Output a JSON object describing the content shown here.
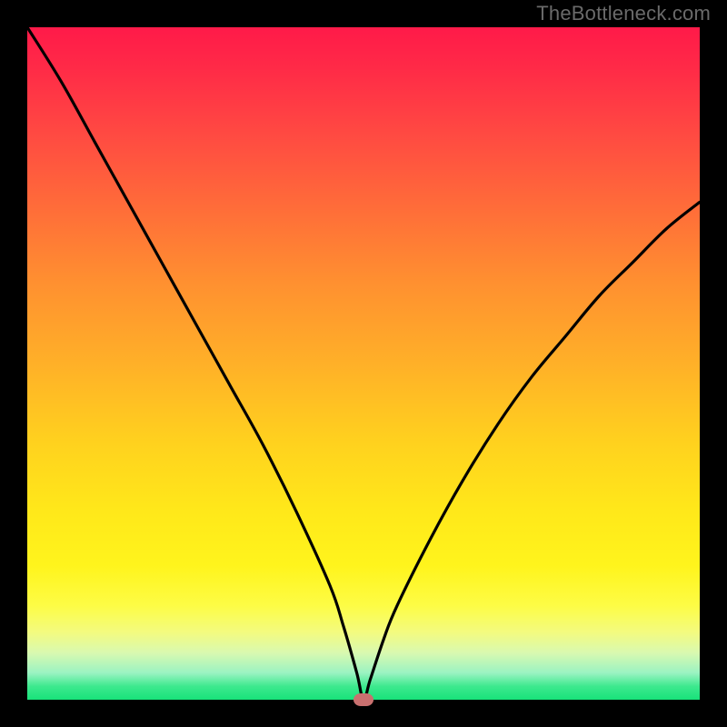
{
  "watermark": "TheBottleneck.com",
  "colors": {
    "frame": "#000000",
    "curve": "#000000",
    "marker": "#c9706f"
  },
  "chart_data": {
    "type": "line",
    "title": "",
    "xlabel": "",
    "ylabel": "",
    "xlim": [
      0,
      100
    ],
    "ylim": [
      0,
      100
    ],
    "grid": false,
    "legend": false,
    "x": [
      0,
      5,
      10,
      15,
      20,
      25,
      30,
      35,
      40,
      45,
      47,
      49,
      50,
      51,
      53,
      55,
      60,
      65,
      70,
      75,
      80,
      85,
      90,
      95,
      100
    ],
    "values": [
      100,
      92,
      83,
      74,
      65,
      56,
      47,
      38,
      28,
      17,
      11,
      4,
      0,
      3,
      9,
      14,
      24,
      33,
      41,
      48,
      54,
      60,
      65,
      70,
      74
    ],
    "marker": {
      "x": 50,
      "y": 0
    },
    "background_gradient": {
      "direction": "vertical",
      "stops": [
        {
          "pos": 0.0,
          "color": "#ff1a49"
        },
        {
          "pos": 0.5,
          "color": "#ffb028"
        },
        {
          "pos": 0.8,
          "color": "#fff41c"
        },
        {
          "pos": 1.0,
          "color": "#18e27a"
        }
      ]
    }
  }
}
